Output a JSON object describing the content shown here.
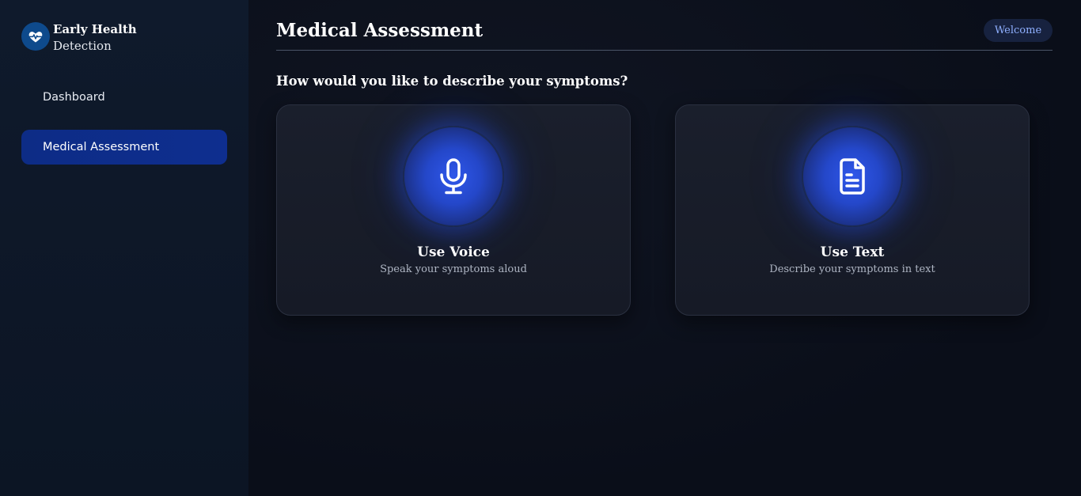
{
  "brand": {
    "line1": "Early Health",
    "line2": "Detection",
    "icon": "heart-pulse-icon"
  },
  "sidebar": {
    "items": [
      {
        "label": "Dashboard",
        "active": false
      },
      {
        "label": "Medical Assessment",
        "active": true
      }
    ]
  },
  "header": {
    "title": "Medical Assessment",
    "welcome": "Welcome"
  },
  "main": {
    "question": "How would you like to describe your symptoms?",
    "options": [
      {
        "title": "Use Voice",
        "description": "Speak your symptoms aloud",
        "icon": "microphone-icon"
      },
      {
        "title": "Use Text",
        "description": "Describe your symptoms in text",
        "icon": "document-icon"
      }
    ]
  },
  "colors": {
    "accent": "#2f57ea",
    "active_nav": "#0e2e8f",
    "background": "#0b101c"
  }
}
